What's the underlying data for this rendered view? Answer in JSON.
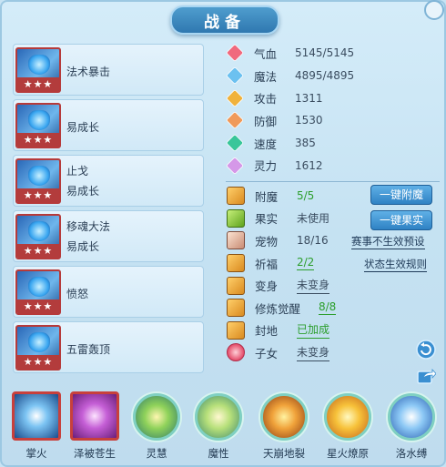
{
  "title": "战备",
  "skills": [
    {
      "lines": [
        "法术暴击"
      ],
      "stars": "★★★"
    },
    {
      "lines": [
        "易成长"
      ],
      "stars": "★★★"
    },
    {
      "lines": [
        "止戈",
        "易成长"
      ],
      "stars": "★★★"
    },
    {
      "lines": [
        "移魂大法",
        "易成长"
      ],
      "stars": "★★★"
    },
    {
      "lines": [
        "愤怒"
      ],
      "stars": "★★★"
    },
    {
      "lines": [
        "五雷轰顶"
      ],
      "stars": "★★★"
    }
  ],
  "attributes": [
    {
      "label": "气血",
      "value": "5145/5145",
      "color": "#f06a7e"
    },
    {
      "label": "魔法",
      "value": "4895/4895",
      "color": "#6cc1f0"
    },
    {
      "label": "攻击",
      "value": "1311",
      "color": "#f0b23c"
    },
    {
      "label": "防御",
      "value": "1530",
      "color": "#f09a5a"
    },
    {
      "label": "速度",
      "value": "385",
      "color": "#39c69a"
    },
    {
      "label": "灵力",
      "value": "1612",
      "color": "#d598e8"
    }
  ],
  "status": [
    {
      "label": "附魔",
      "value": "5/5",
      "style": "green"
    },
    {
      "label": "果实",
      "value": "未使用",
      "style": "dark"
    },
    {
      "label": "宠物",
      "value": "18/16",
      "style": "dark"
    },
    {
      "label": "祈福",
      "value": "2/2",
      "style": "green-ul"
    },
    {
      "label": "变身",
      "value": "未变身",
      "style": "dark-ul"
    },
    {
      "label": "修炼觉醒",
      "value": "8/8",
      "style": "green-ul"
    },
    {
      "label": "封地",
      "value": "已加成",
      "style": "green-ul"
    },
    {
      "label": "子女",
      "value": "未变身",
      "style": "dark-ul"
    }
  ],
  "buttons": {
    "enchant": "一键附魔",
    "fruit": "一键果实"
  },
  "links": {
    "preset": "赛事不生效预设",
    "state_rule": "状态生效规则"
  },
  "bottom_items": [
    {
      "label": "掌火"
    },
    {
      "label": "泽被苍生"
    },
    {
      "label": "灵慧"
    },
    {
      "label": "魔性"
    },
    {
      "label": "天崩地裂"
    },
    {
      "label": "星火燎原"
    },
    {
      "label": "洛水缚"
    }
  ],
  "colors": {
    "accent_blue": "#2f82c4",
    "green_value": "#2c9e2c",
    "frame_red": "#c8403c"
  },
  "icons": {
    "close": "close-icon",
    "refresh": "refresh-icon",
    "share": "share-icon"
  }
}
